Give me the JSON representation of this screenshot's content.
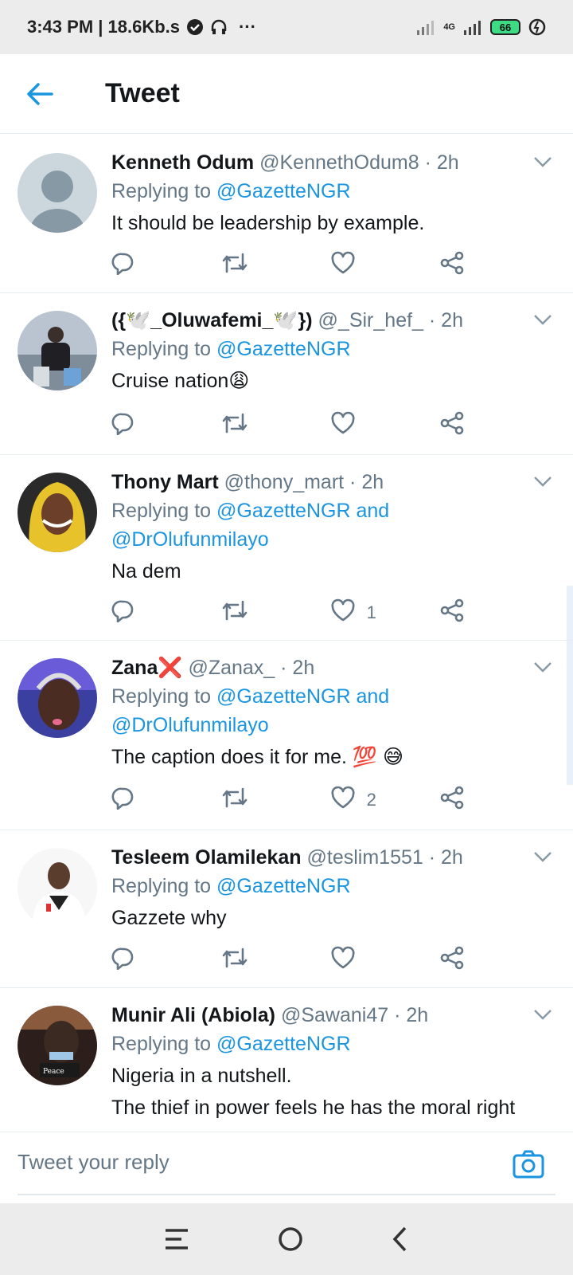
{
  "status_bar": {
    "time_speed": "3:43 PM | 18.6Kb.s",
    "more": "···",
    "network": "4G",
    "battery": "66"
  },
  "header": {
    "title": "Tweet"
  },
  "tweets": [
    {
      "name": "Kenneth Odum",
      "meta": "@KennethOdum8 · 2h",
      "reply_prefix": "Replying to ",
      "reply_to": "@GazetteNGR",
      "reply_to2": "",
      "text": "It should be leadership by example.",
      "text2": "",
      "likes": ""
    },
    {
      "name": "({🕊️_Oluwafemi_🕊️})",
      "meta": "@_Sir_hef_ · 2h",
      "reply_prefix": "Replying to ",
      "reply_to": "@GazetteNGR",
      "reply_to2": "",
      "text": "Cruise nation😩",
      "text2": "",
      "likes": ""
    },
    {
      "name": "Thony Mart",
      "meta": "@thony_mart · 2h",
      "reply_prefix": "Replying to ",
      "reply_to": "@GazetteNGR and",
      "reply_to2": "@DrOlufunmilayo",
      "text": "Na dem",
      "text2": "",
      "likes": "1"
    },
    {
      "name": "Zana❌",
      "meta": "@Zanax_ · 2h",
      "reply_prefix": "Replying to ",
      "reply_to": "@GazetteNGR and",
      "reply_to2": "@DrOlufunmilayo",
      "text": "The caption does it for me. 💯 😅",
      "text2": "",
      "likes": "2"
    },
    {
      "name": "Tesleem Olamilekan",
      "meta": "@teslim1551 · 2h",
      "reply_prefix": "Replying to ",
      "reply_to": "@GazetteNGR",
      "reply_to2": "",
      "text": "Gazzete why",
      "text2": "",
      "likes": ""
    },
    {
      "name": "Munir Ali (Abiola)",
      "meta": "@Sawani47 · 2h",
      "reply_prefix": "Replying to ",
      "reply_to": "@GazetteNGR",
      "reply_to2": "",
      "text": "Nigeria in a nutshell.",
      "text2": "The thief in power feels he has the moral right",
      "likes": ""
    }
  ],
  "composer": {
    "placeholder": "Tweet your reply"
  },
  "colors": {
    "accent": "#1b95e0",
    "muted": "#657786",
    "text": "#14171a"
  }
}
